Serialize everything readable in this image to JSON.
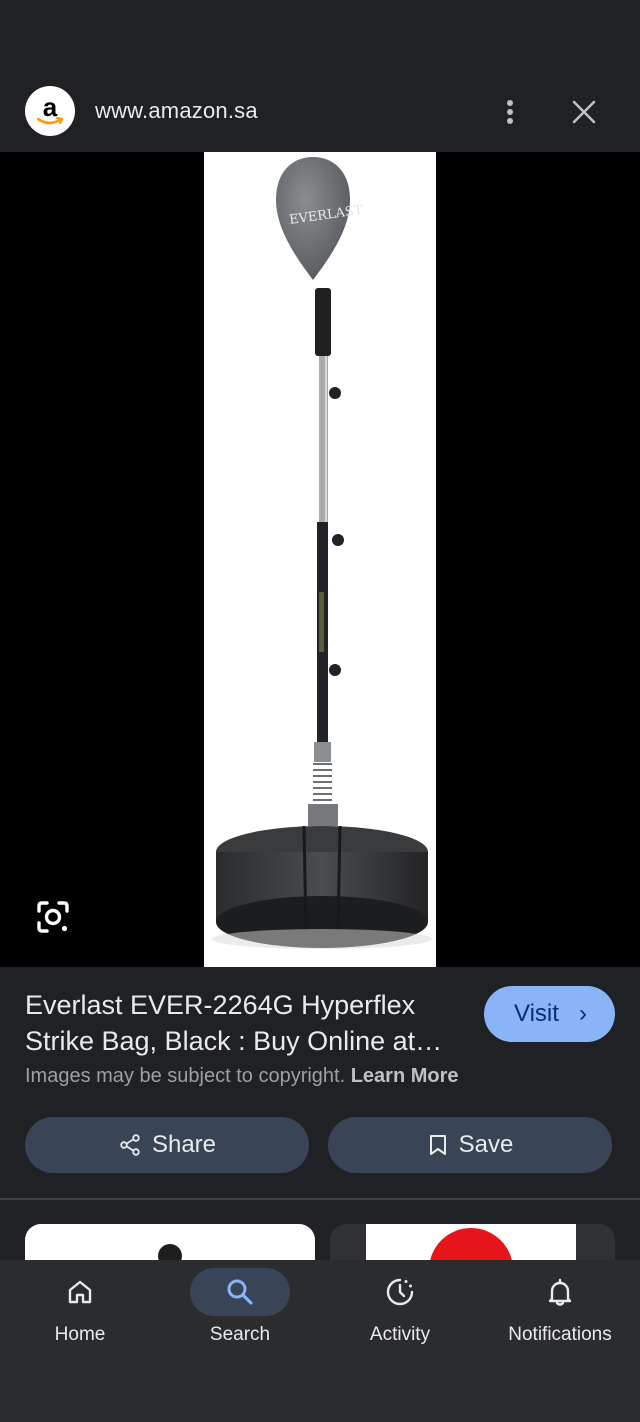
{
  "browser": {
    "url": "www.amazon.sa",
    "logo_letter": "a"
  },
  "product": {
    "title_line1": "Everlast EVER-2264G Hyperflex",
    "title_line2": "Strike Bag, Black : Buy Online at…",
    "brand_on_image": "EVERLAST"
  },
  "actions": {
    "visit_label": "Visit",
    "visit_chevron": "›",
    "share_label": "Share",
    "save_label": "Save"
  },
  "notice": {
    "text": "Images may be subject to copyright.",
    "link": "Learn More"
  },
  "nav": {
    "items": [
      {
        "label": "Home",
        "icon": "home-icon"
      },
      {
        "label": "Search",
        "icon": "search-icon",
        "active": true
      },
      {
        "label": "Activity",
        "icon": "activity-icon"
      },
      {
        "label": "Notifications",
        "icon": "bell-icon"
      }
    ]
  },
  "colors": {
    "background": "#202124",
    "accent": "#8ab4f8",
    "button_bg": "#394457",
    "nav_bg": "#2b2c30"
  }
}
